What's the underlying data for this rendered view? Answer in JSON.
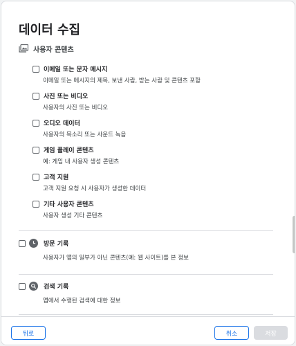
{
  "dialog": {
    "title": "데이터 수집"
  },
  "section": {
    "icon": "photo-library-icon",
    "label": "사용자 콘텐츠"
  },
  "items": [
    {
      "title": "이메일 또는 문자 메시지",
      "desc": "이메일 또는 메시지의 제목, 보낸 사람, 받는 사람 및 콘텐츠 포함",
      "checked": false
    },
    {
      "title": "사진 또는 비디오",
      "desc": "사용자의 사진 또는 비디오",
      "checked": false
    },
    {
      "title": "오디오 데이터",
      "desc": "사용자의 목소리 또는 사운드 녹음",
      "checked": false
    },
    {
      "title": "게임 플레이 콘텐츠",
      "desc": "예: 게임 내 사용자 생성 콘텐츠",
      "checked": false
    },
    {
      "title": "고객 지원",
      "desc": "고객 지원 요청 시 사용자가 생성한 데이터",
      "checked": false
    },
    {
      "title": "기타 사용자 콘텐츠",
      "desc": "사용자 생성 기타 콘텐츠",
      "checked": false
    }
  ],
  "categories": [
    {
      "icon": "history-icon",
      "title": "방문 기록",
      "desc": "사용자가 앱의 일부가 아닌 콘텐츠(예: 웹 사이트)를 본 정보",
      "checked": false
    },
    {
      "icon": "search-icon",
      "title": "검색 기록",
      "desc": "앱에서 수행된 검색에 대한 정보",
      "checked": false
    }
  ],
  "footer": {
    "back_label": "뒤로",
    "cancel_label": "취소",
    "save_label": "저장"
  },
  "colors": {
    "accent": "#1a73e8",
    "disabled": "#dadce0"
  }
}
